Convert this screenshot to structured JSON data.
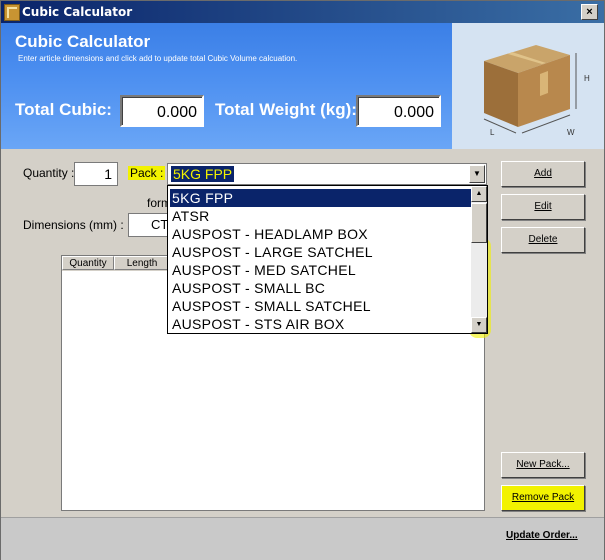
{
  "window": {
    "title": "Cubic Calculator",
    "close_symbol": "×"
  },
  "header": {
    "title": "Cubic Calculator",
    "subtitle": "Enter article dimensions and click add to update total Cubic Volume calcuation.",
    "total_cubic_label": "Total Cubic:",
    "total_cubic_value": "0.000",
    "total_weight_label": "Total Weight (kg):",
    "total_weight_value": "0.000"
  },
  "box_image": {
    "label_h": "H",
    "label_l": "L",
    "label_w": "W"
  },
  "form": {
    "quantity_label": "Quantity :",
    "quantity_value": "1",
    "pack_label": "Pack :",
    "pack_selected": "5KG FPP",
    "format_label": "form",
    "dimensions_label": "Dimensions (mm) :",
    "dimension_value": "CT"
  },
  "table": {
    "columns": [
      "Quantity",
      "Length"
    ]
  },
  "dropdown": {
    "items": [
      "5KG FPP",
      "ATSR",
      "AUSPOST - HEADLAMP BOX",
      "AUSPOST - LARGE SATCHEL",
      "AUSPOST - MED SATCHEL",
      "AUSPOST - SMALL BC",
      "AUSPOST - SMALL SATCHEL",
      "AUSPOST - STS AIR BOX"
    ],
    "selected_index": 0
  },
  "buttons": {
    "add": "Add",
    "edit": "Edit",
    "delete": "Delete",
    "new_pack": "New Pack...",
    "remove_pack": "Remove Pack",
    "update_order": "Update Order..."
  },
  "colors": {
    "highlight": "#f2f200",
    "selection": "#0a246a",
    "header_blue": "#4b8ef0"
  }
}
